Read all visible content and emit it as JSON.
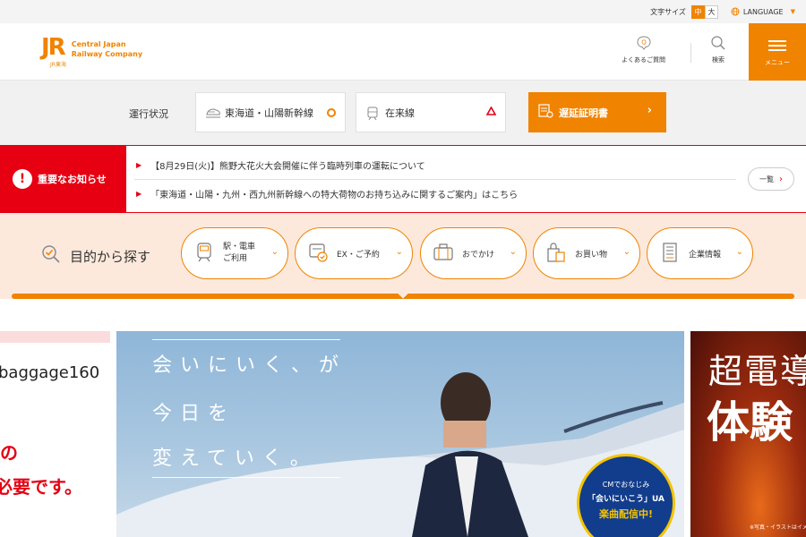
{
  "top_bar": {
    "font_size_label": "文字サイズ",
    "font_size_medium": "中",
    "font_size_large": "大",
    "language_label": "LANGUAGE"
  },
  "header": {
    "logo_mark": "JR",
    "logo_sub": "JR東海",
    "company_line1": "Central Japan",
    "company_line2": "Railway Company",
    "faq_label": "よくあるご質問",
    "search_label": "検索",
    "menu_label": "メニュー"
  },
  "operation_status": {
    "title": "運行状況",
    "shinkansen_label": "東海道・山陽新幹線",
    "shinkansen_status": "○",
    "conventional_label": "在来線",
    "conventional_status": "△",
    "delay_certificate_label": "遅延証明書"
  },
  "notices": {
    "label": "重要なお知らせ",
    "items": [
      "【8月29日(火)】熊野大花火大会開催に伴う臨時列車の運転について",
      "「東海道・山陽・九州・西九州新幹線への特大荷物のお持ち込みに関するご案内」はこちら"
    ],
    "list_button": "一覧"
  },
  "purpose": {
    "title": "目的から探す",
    "buttons": {
      "station": "駅・電車\nご利用",
      "ex": "EX・ご予約",
      "outing": "おでかけ",
      "shopping": "お買い物",
      "corporate": "企業情報"
    }
  },
  "banners": {
    "left_text": "baggage160",
    "left_red1": "の",
    "left_red2": "必要です。",
    "main_copy1": "会いにいく、が",
    "main_copy2": "今日を",
    "main_copy3": "変えていく。",
    "badge_line1": "CMでおなじみ",
    "badge_line2": "「会いにいこう」UA",
    "badge_line3": "楽曲配信中!",
    "right_title1": "超電導",
    "right_title2": "体験",
    "right_note": "※写真・イラストはイメージです。"
  },
  "colors": {
    "brand_orange": "#f08300",
    "alert_red": "#e60012",
    "purpose_bg": "#fde9dc"
  }
}
